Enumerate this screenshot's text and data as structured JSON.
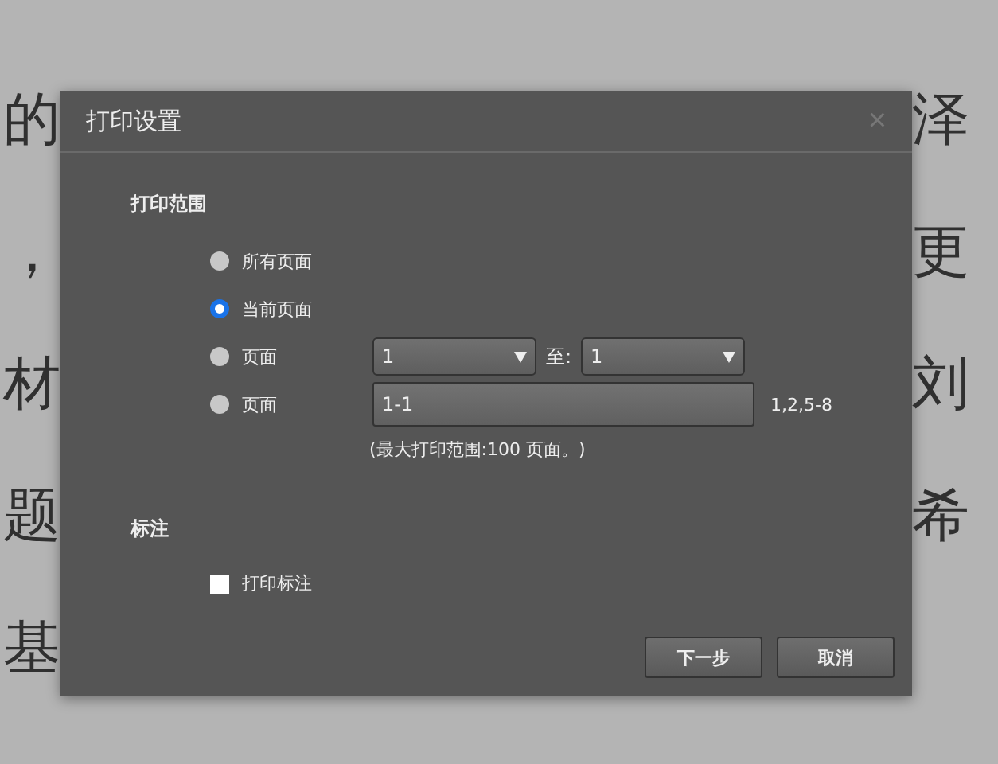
{
  "background_text": {
    "left": [
      "的",
      "，",
      "材",
      "题",
      "基"
    ],
    "right": [
      "泽",
      "更",
      "刘",
      "希"
    ]
  },
  "dialog": {
    "title": "打印设置",
    "close": "×",
    "range": {
      "heading": "打印范围",
      "options": [
        {
          "kind": "plain",
          "label": "所有页面",
          "selected": false
        },
        {
          "kind": "plain",
          "label": "当前页面",
          "selected": true
        },
        {
          "kind": "select",
          "label": "页面",
          "selected": false,
          "from": "1",
          "to_label": "至:",
          "to": "1"
        },
        {
          "kind": "input",
          "label": "页面",
          "selected": false,
          "value": "1-1",
          "example": "1,2,5-8"
        }
      ],
      "note": "(最大打印范围:100 页面。)"
    },
    "annotations": {
      "heading": "标注",
      "checkbox": {
        "label": "打印标注",
        "checked": false
      }
    },
    "buttons": [
      "下一步",
      "取消"
    ]
  }
}
